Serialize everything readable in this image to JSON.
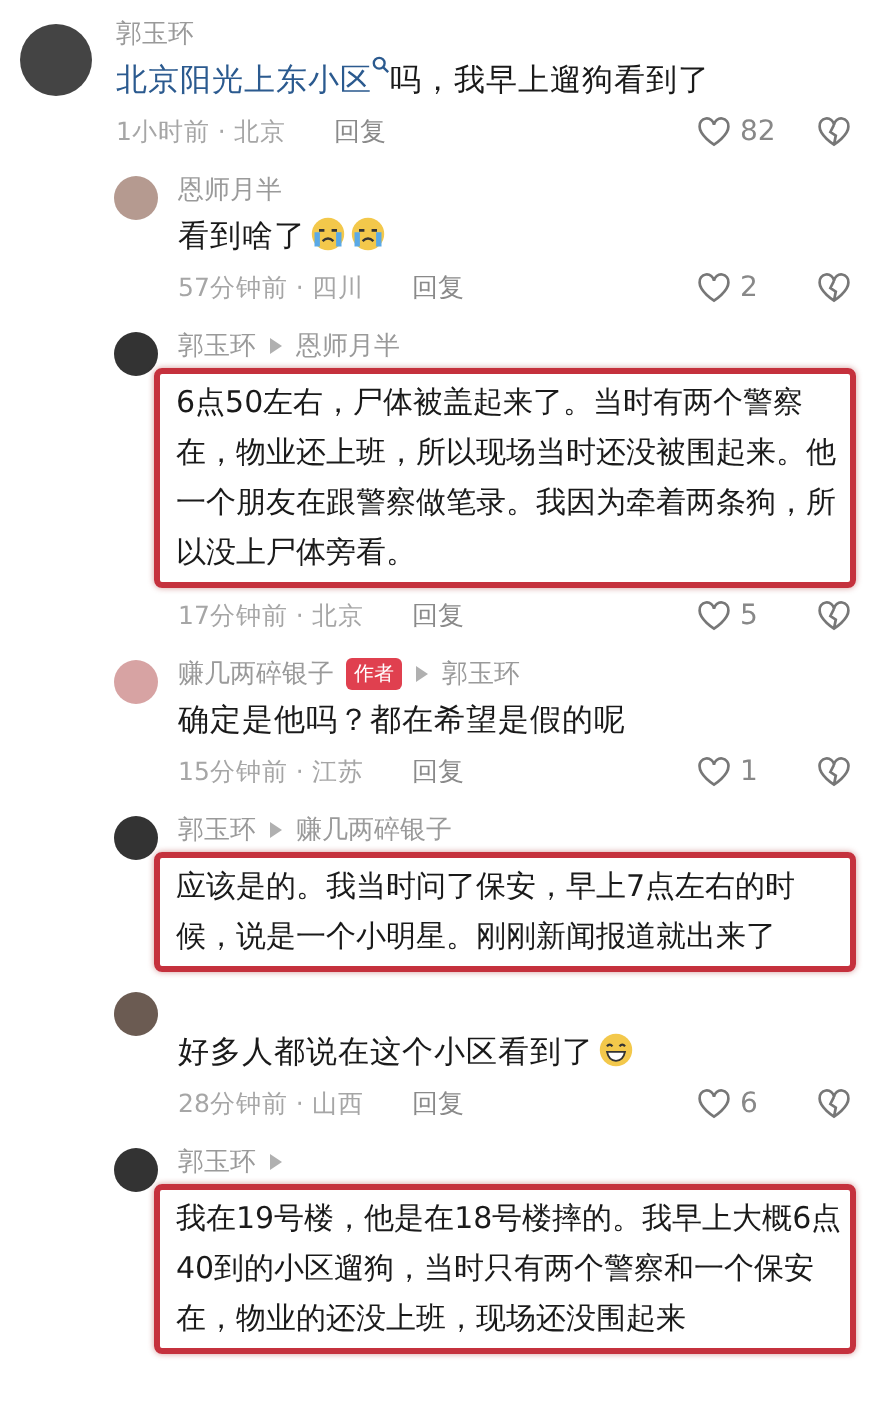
{
  "comments": [
    {
      "kind": "top",
      "name": "郭玉环",
      "link": "北京阳光上东小区",
      "text": "吗，我早上遛狗看到了",
      "highlighted": false,
      "meta": "1小时前 · 北京",
      "reply": "回复",
      "likes": "82"
    },
    {
      "kind": "reply",
      "name": "恩师月半",
      "text": "看到啥了",
      "emojis": [
        {
          "kind": "crying"
        },
        {
          "kind": "crying"
        }
      ],
      "highlighted": false,
      "meta": "57分钟前 · 四川",
      "reply": "回复",
      "likes": "2"
    },
    {
      "kind": "reply",
      "name": "郭玉环",
      "reply_to": "恩师月半",
      "text": "6点50左右，尸体被盖起来了。当时有两个警察在，物业还上班，所以现场当时还没被围起来。他一个朋友在跟警察做笔录。我因为牵着两条狗，所以没上尸体旁看。",
      "highlighted": true,
      "meta": "17分钟前 · 北京",
      "reply": "回复",
      "likes": "5"
    },
    {
      "kind": "reply",
      "name": "赚几两碎银子",
      "badge": "作者",
      "reply_to": "郭玉环",
      "text": "确定是他吗？都在希望是假的呢",
      "highlighted": false,
      "meta": "15分钟前 · 江苏",
      "reply": "回复",
      "likes": "1"
    },
    {
      "kind": "reply",
      "name": "郭玉环",
      "reply_to": "赚几两碎银子",
      "text": "应该是的。我当时问了保安，早上7点左右的时候，说是一个小明星。刚刚新闻报道就出来了",
      "highlighted": true
    },
    {
      "kind": "reply",
      "text": "好多人都说在这个小区看到了",
      "emojis": [
        {
          "kind": "grin"
        }
      ],
      "highlighted": false,
      "meta": "28分钟前 · 山西",
      "reply": "回复",
      "likes": "6"
    },
    {
      "kind": "reply",
      "name": "郭玉环",
      "arrow": true,
      "text": "我在19号楼，他是在18号楼摔的。我早上大概6点40到的小区遛狗，当时只有两个警察和一个保安在，物业的还没上班，现场还没围起来",
      "highlighted": true
    }
  ]
}
